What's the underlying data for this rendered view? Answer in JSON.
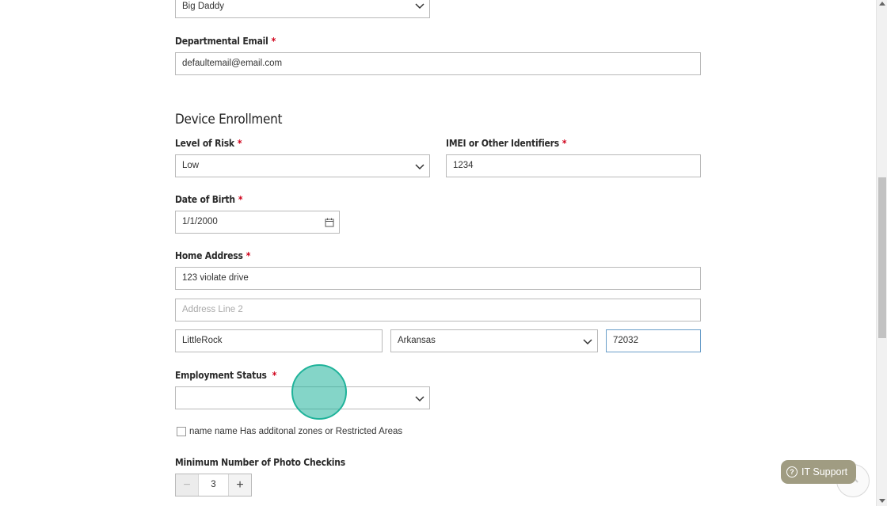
{
  "form": {
    "top_select_value": "Big Daddy",
    "departmental_email": {
      "label": "Departmental Email",
      "value": "defaultemail@email.com"
    },
    "required_mark": "*",
    "section_title": "Device Enrollment",
    "level_of_risk": {
      "label": "Level of Risk",
      "value": "Low"
    },
    "imei": {
      "label": "IMEI or Other Identifiers",
      "value": "1234"
    },
    "date_of_birth": {
      "label": "Date of Birth",
      "value": "1/1/2000"
    },
    "home_address": {
      "label": "Home Address",
      "line1": "123 violate drive",
      "line2_placeholder": "Address Line 2",
      "city": "LittleRock",
      "state": "Arkansas",
      "zip": "72032"
    },
    "employment_status": {
      "label": "Employment Status",
      "value": ""
    },
    "restricted_checkbox": {
      "label": "name name Has additonal zones or Restricted Areas",
      "checked": false
    },
    "photo_checkins": {
      "label": "Minimum Number of Photo Checkins",
      "value": "3",
      "minus": "−",
      "plus": "+"
    }
  },
  "support_button": {
    "label": "IT Support",
    "icon": "question-circle-icon",
    "color": "#a09c82"
  },
  "colors": {
    "cursor_highlight": "#1fb39a",
    "required": "#d0021b",
    "focus_border": "#6a9ec9"
  }
}
